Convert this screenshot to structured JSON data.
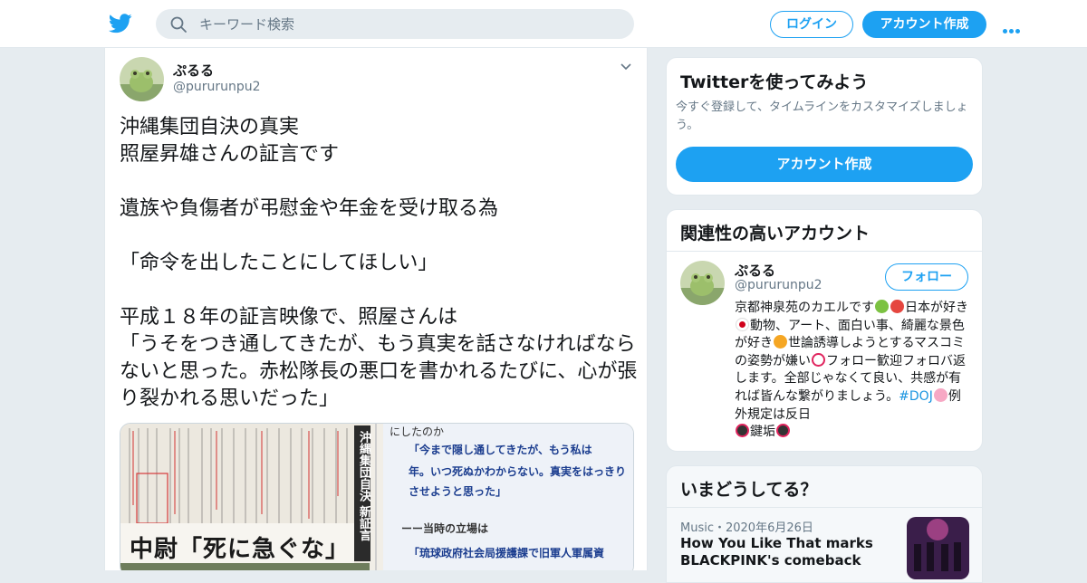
{
  "header": {
    "search_placeholder": "キーワード検索",
    "login_label": "ログイン",
    "signup_label": "アカウント作成",
    "brand_color": "#1da1f2"
  },
  "tweet": {
    "author_name": "ぷるる",
    "author_handle": "@pururunpu2",
    "text": "沖縄集団自決の真実\n照屋昇雄さんの証言です\n\n遺族や負傷者が弔慰金や年金を受け取る為\n\n「命令を出したことにしてほしい」\n\n平成１８年の証言映像で、照屋さんは\n「うそをつき通してきたが、もう真実を話さなければならないと思った。赤松隊長の悪口を書かれるたびに、心が張り裂かれる思いだった」",
    "media": {
      "vertical_heading": "沖縄集団自決 新証言",
      "big_headline": "中尉「死に急ぐな」",
      "right_top": "にしたのか",
      "quote1_lines": [
        "「今まで隠し通してきたが、もう私は",
        "年。いつ死ぬかわからない。真実をはっきり",
        "させようと思った」"
      ],
      "question": "ーー当時の立場は",
      "quote2_lines": [
        "「琉球政府社会局援護課で旧軍人軍属資"
      ]
    }
  },
  "sidebar": {
    "try": {
      "title": "Twitterを使ってみよう",
      "description": "今すぐ登録して、タイムラインをカスタマイズしましょう。",
      "button_label": "アカウント作成"
    },
    "related": {
      "title": "関連性の高いアカウント",
      "name": "ぷるる",
      "handle": "@pururunpu2",
      "follow_label": "フォロー",
      "bio_part1": "京都神泉苑のカエルです",
      "bio_part2": "日本が好き",
      "bio_part3": "動物、アート、面白い事、綺麗な景色が好き",
      "bio_part4": "世論誘導しようとするマスコミの姿勢が嫌い",
      "bio_part5": "フォロー歓迎フォロバ返します。全部じゃなくて良い、共感が有れば皆んな繋がりましょう。",
      "bio_tag": "#DOJ",
      "bio_part6": "例外規定は反日",
      "bio_part7": "鍵垢"
    },
    "trends": {
      "title": "いまどうしてる？",
      "item_meta": "Music・2020年6月26日",
      "item_title": "How You Like That marks BLACKPINK's comeback"
    }
  }
}
